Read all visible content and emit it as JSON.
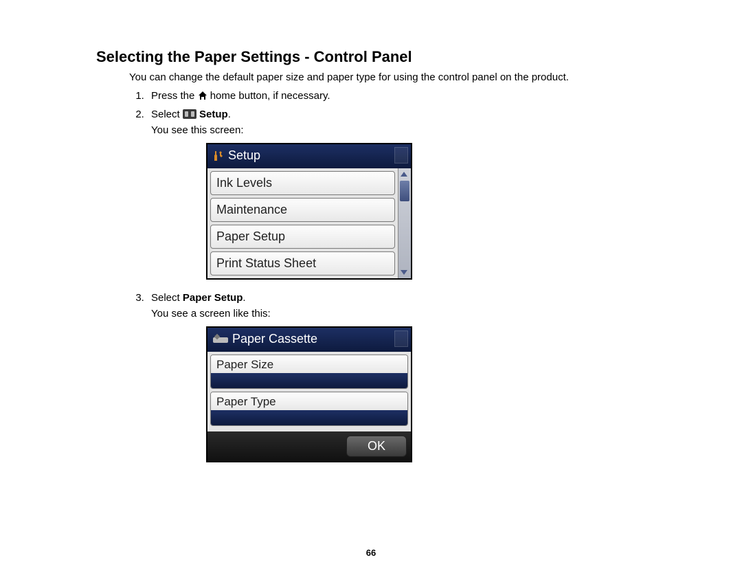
{
  "title": "Selecting the Paper Settings - Control Panel",
  "intro": "You can change the default paper size and paper type for using the control panel on the product.",
  "steps": {
    "s1_prefix": "Press the ",
    "s1_suffix": " home button, if necessary.",
    "s2_prefix": "Select ",
    "s2_bold": " Setup",
    "s2_suffix": ".",
    "s2_after": "You see this screen:",
    "s3_prefix": "Select ",
    "s3_bold": "Paper Setup",
    "s3_suffix": ".",
    "s3_after": "You see a screen like this:"
  },
  "screen1": {
    "title": "Setup",
    "items": [
      "Ink Levels",
      "Maintenance",
      "Paper Setup",
      "Print Status Sheet"
    ]
  },
  "screen2": {
    "title": "Paper Cassette",
    "field1": "Paper Size",
    "field2": "Paper Type",
    "ok": "OK"
  },
  "pageNumber": "66"
}
